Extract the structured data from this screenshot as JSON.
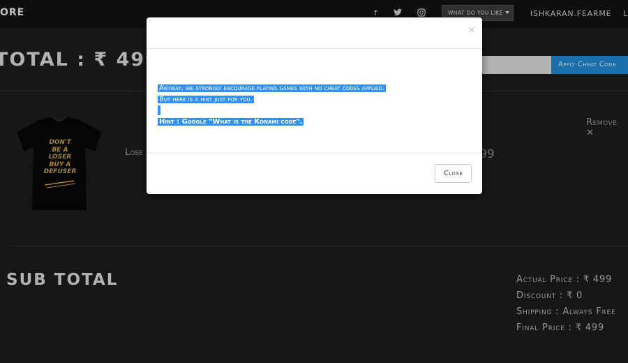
{
  "navbar": {
    "brand": "ORE",
    "social": [
      {
        "icon": "facebook-icon",
        "glyph": "f"
      },
      {
        "icon": "twitter-icon",
        "glyph": "t"
      },
      {
        "icon": "instagram-icon",
        "glyph": "◘"
      }
    ],
    "dropdown_label": "What do you like",
    "user": "ishkaran.fearme",
    "cut_item": "L"
  },
  "cart": {
    "total_heading": "TOTAL : ₹ 499",
    "cheat_button": "Apply Cheat Code",
    "remove_label": "Remove ✕",
    "item_name": "Lose",
    "item_price_fragment": "99",
    "tshirt_lines": [
      "DON'T",
      "BE A",
      "LOSER",
      "BUY A",
      "DEFUSER"
    ]
  },
  "summary": {
    "heading": "SUB TOTAL",
    "actual_price": "Actual Price : ₹ 499",
    "discount": "Discount : ₹ 0",
    "shipping": "Shipping : Always Free",
    "final_price": "Final Price : ₹ 499"
  },
  "modal": {
    "close_x": "×",
    "line1": "Anyway, we strongly encourage playing games with no cheat codes applied.",
    "line2": "But here is a hint just for you.",
    "hint": "Hint : Google \"What is the Konami code\".",
    "close_button": "Close"
  }
}
